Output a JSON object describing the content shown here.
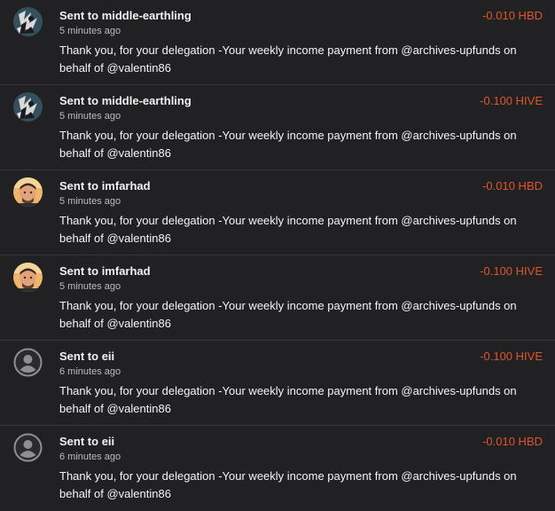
{
  "colors": {
    "background": "#212124",
    "amount": "#e0542a",
    "divider": "#36363a"
  },
  "transactions": [
    {
      "prefix": "Sent to",
      "recipient": "middle-earthling",
      "time": "5 minutes ago",
      "amount": "-0.010 HBD",
      "memo": "Thank you, for your delegation -Your weekly income payment from @archives-upfunds on behalf of @valentin86",
      "avatar_icon": "art-avatar"
    },
    {
      "prefix": "Sent to",
      "recipient": "middle-earthling",
      "time": "5 minutes ago",
      "amount": "-0.100 HIVE",
      "memo": "Thank you, for your delegation -Your weekly income payment from @archives-upfunds on behalf of @valentin86",
      "avatar_icon": "art-avatar"
    },
    {
      "prefix": "Sent to",
      "recipient": "imfarhad",
      "time": "5 minutes ago",
      "amount": "-0.010 HBD",
      "memo": "Thank you, for your delegation -Your weekly income payment from @archives-upfunds on behalf of @valentin86",
      "avatar_icon": "face-photo-avatar"
    },
    {
      "prefix": "Sent to",
      "recipient": "imfarhad",
      "time": "5 minutes ago",
      "amount": "-0.100 HIVE",
      "memo": "Thank you, for your delegation -Your weekly income payment from @archives-upfunds on behalf of @valentin86",
      "avatar_icon": "face-photo-avatar"
    },
    {
      "prefix": "Sent to",
      "recipient": "eii",
      "time": "6 minutes ago",
      "amount": "-0.100 HIVE",
      "memo": "Thank you, for your delegation -Your weekly income payment from @archives-upfunds on behalf of @valentin86",
      "avatar_icon": "default-user-avatar"
    },
    {
      "prefix": "Sent to",
      "recipient": "eii",
      "time": "6 minutes ago",
      "amount": "-0.010 HBD",
      "memo": "Thank you, for your delegation -Your weekly income payment from @archives-upfunds on behalf of @valentin86",
      "avatar_icon": "default-user-avatar"
    }
  ]
}
